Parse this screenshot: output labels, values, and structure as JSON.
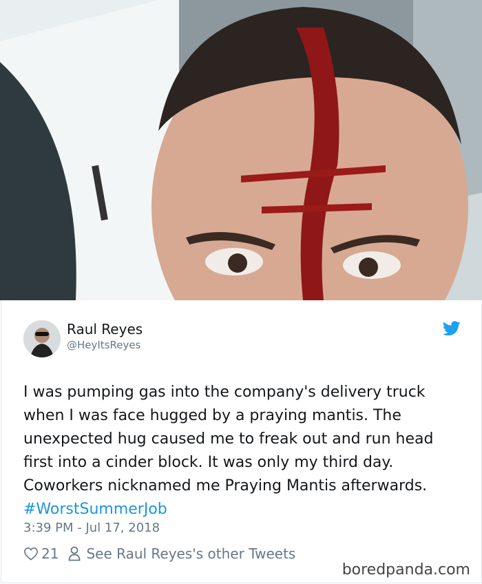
{
  "photo": {
    "icon": "selfie-photo"
  },
  "tweet": {
    "author_name": "Raul Reyes",
    "author_handle": "@HeyItsReyes",
    "text_main": "I was pumping gas into the company's delivery truck when I was face hugged by a praying mantis. The unexpected hug caused me to freak out and run head first into a cinder block. It was only my third day. Coworkers nicknamed me Praying Mantis afterwards. ",
    "hashtag": "#WorstSummerJob",
    "timestamp": "3:39 PM - Jul 17, 2018",
    "like_count": "21",
    "other_tweets_link": "See Raul Reyes's other Tweets"
  },
  "watermark": "boredpanda.com",
  "colors": {
    "link": "#1b95e0",
    "secondary_text": "#657786",
    "primary_text": "#14171a"
  }
}
